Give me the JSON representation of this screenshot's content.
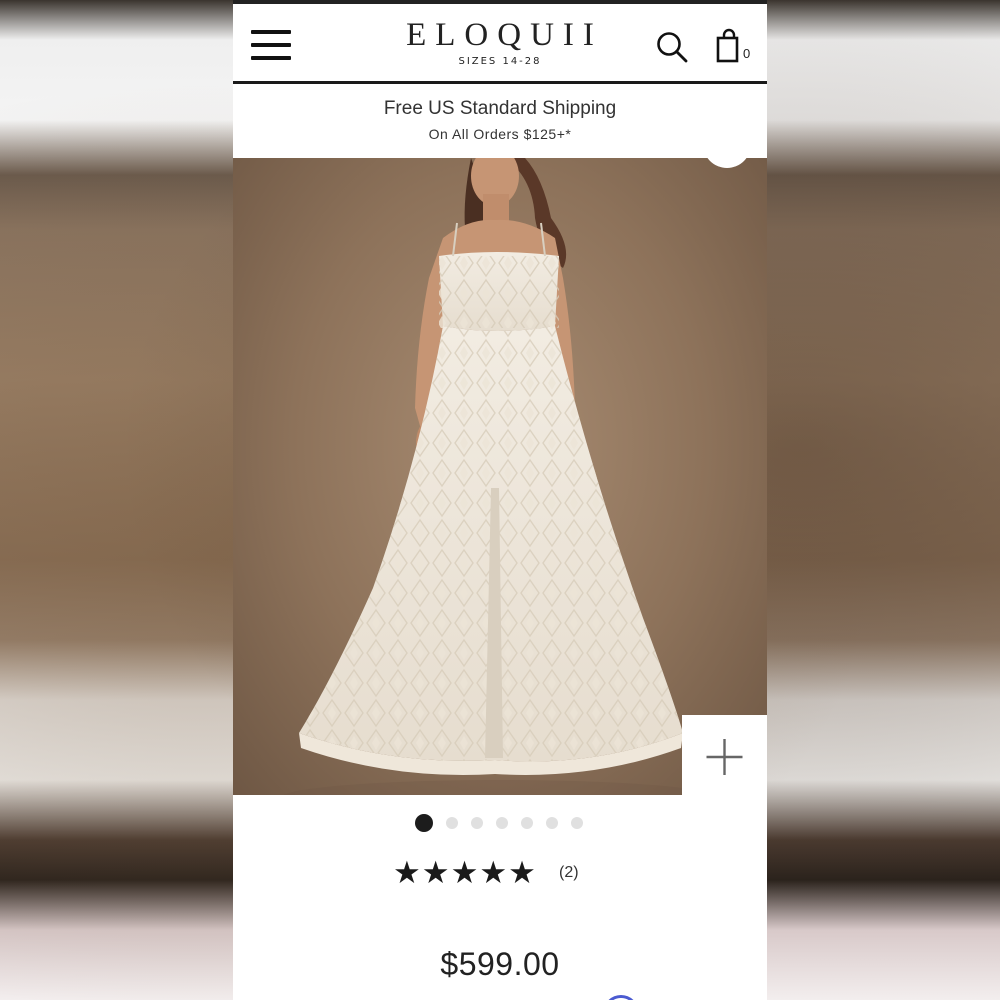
{
  "header": {
    "brand": "ELOQUII",
    "brand_sub": "SIZES 14-28",
    "cart_count": "0",
    "icons": [
      "menu-icon",
      "search-icon",
      "shopping-bag-icon"
    ]
  },
  "promo": {
    "line1": "Free US Standard Shipping",
    "line2": "On All Orders $125+*"
  },
  "gallery": {
    "image_count": 7,
    "active_index": 0,
    "zoom_icon": "plus-icon"
  },
  "product": {
    "stars": "★★★★★",
    "rating": 5,
    "review_count": "(2)",
    "price": "$599.00"
  },
  "colors": {
    "text": "#222222",
    "active_dot": "#1c1c1c",
    "inactive_dot": "#e0e0e0",
    "chat_accent": "#4b5bd1"
  }
}
